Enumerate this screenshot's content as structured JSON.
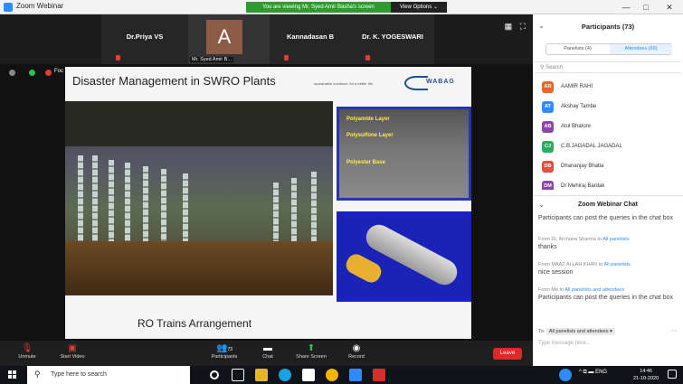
{
  "window": {
    "title": "Zoom Webinar",
    "banner": "You are viewing Mr. Syed Amir Basha's screen",
    "view_options": "View Options ⌄",
    "min": "—",
    "max": "□",
    "close": "✕"
  },
  "strip": {
    "tiles": [
      {
        "name": "Dr.Priya VS"
      },
      {
        "name": "",
        "avatar_letter": "A",
        "label": "Mr. Syed Amir B..."
      },
      {
        "name": "Kannadasan B"
      },
      {
        "name": "Dr. K. YOGESWARI"
      }
    ]
  },
  "slide": {
    "title": "Disaster Management in SWRO Plants",
    "tagline": "sustainable solutions. for a better life.",
    "logo_text": "WABAG",
    "layers": [
      "Polyamide Layer",
      "Polysulfone Layer",
      "Polyester Base"
    ],
    "caption": "RO Trains Arrangement"
  },
  "share_toolbar": {
    "item_text": "Foc"
  },
  "participants": {
    "title": "Participants (73)",
    "tabs": [
      "Panelists (4)",
      "Attendees (69)"
    ],
    "search_placeholder": "Search",
    "list": [
      {
        "initials": "AR",
        "name": "AAMIR RAHI",
        "color": "#e8672c"
      },
      {
        "initials": "AT",
        "name": "Akshay Tambe",
        "color": "#2d8cff"
      },
      {
        "initials": "AB",
        "name": "Atul Bhatore",
        "color": "#8e44ad"
      },
      {
        "initials": "CJ",
        "name": "C.B.JAGADAL JAGADAL",
        "color": "#27ae60"
      },
      {
        "initials": "DB",
        "name": "Dhananjay Bhatia",
        "color": "#e74c3c"
      },
      {
        "initials": "DM",
        "name": "Dr Mehiraj Bardak",
        "color": "#8e44ad"
      }
    ]
  },
  "chat": {
    "title": "Zoom Webinar Chat",
    "messages": [
      {
        "from": "",
        "to": "",
        "body": "Participants can post the queries in the chat box"
      },
      {
        "from": "From Dr. Archana Sharma to ",
        "to": "All panelists",
        "body": "thanks"
      },
      {
        "from": "From MAAZ ALLAH KHAN to ",
        "to": "All panelists",
        "body": "nice session"
      },
      {
        "from": "From Me to ",
        "to": "All panelists and attendees",
        "body": "Participants can post the queries in the chat box"
      }
    ],
    "to_label": "To:",
    "to_value": "All panelists and attendees ▾",
    "input_placeholder": "Type message here...",
    "more": "···"
  },
  "controls": {
    "unmute": "Unmute",
    "start_video": "Start Video",
    "participants": "Participants",
    "participants_count": "73",
    "chat": "Chat",
    "share": "Share Screen",
    "record": "Record",
    "leave": "Leave"
  },
  "taskbar": {
    "search_placeholder": "Type here to search",
    "tray": "^ ⧉ ▬ ENG",
    "time": "14:46",
    "date": "21-10-2020"
  }
}
